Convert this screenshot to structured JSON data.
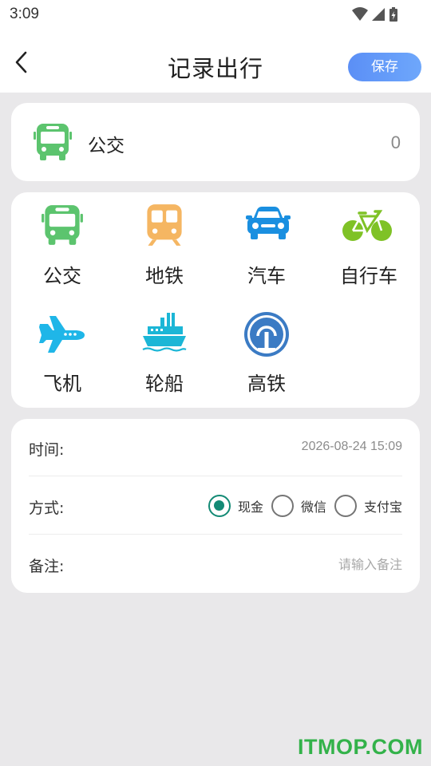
{
  "status_bar": {
    "time": "3:09",
    "icons": [
      "wifi-icon",
      "cell-signal-icon",
      "battery-charging-icon"
    ]
  },
  "app_bar": {
    "back_icon": "chevron-left-icon",
    "title": "记录出行",
    "save_label": "保存"
  },
  "selected": {
    "icon": "bus-icon",
    "name": "公交",
    "amount": "0"
  },
  "transport_options": [
    {
      "label": "公交",
      "icon": "bus-icon",
      "color": "#5cc46e"
    },
    {
      "label": "地铁",
      "icon": "metro-icon",
      "color": "#f5b662"
    },
    {
      "label": "汽车",
      "icon": "car-icon",
      "color": "#1a8fe0"
    },
    {
      "label": "自行车",
      "icon": "bicycle-icon",
      "color": "#7fc226"
    },
    {
      "label": "飞机",
      "icon": "airplane-icon",
      "color": "#1fb6e8"
    },
    {
      "label": "轮船",
      "icon": "ship-icon",
      "color": "#1bb6d6"
    },
    {
      "label": "高铁",
      "icon": "high-speed-rail-icon",
      "color": "#3b7bc4"
    }
  ],
  "form": {
    "time_label": "时间:",
    "time_value": "2026-08-24 15:09",
    "method_label": "方式:",
    "payment_options": [
      {
        "label": "现金",
        "checked": true
      },
      {
        "label": "微信",
        "checked": false
      },
      {
        "label": "支付宝",
        "checked": false
      }
    ],
    "note_label": "备注:",
    "note_placeholder": "请输入备注",
    "note_value": ""
  },
  "colors": {
    "accent": "#5b8ff6",
    "radio_checked": "#138a75",
    "watermark": "#33b24a"
  },
  "watermark": "ITMOP.COM"
}
